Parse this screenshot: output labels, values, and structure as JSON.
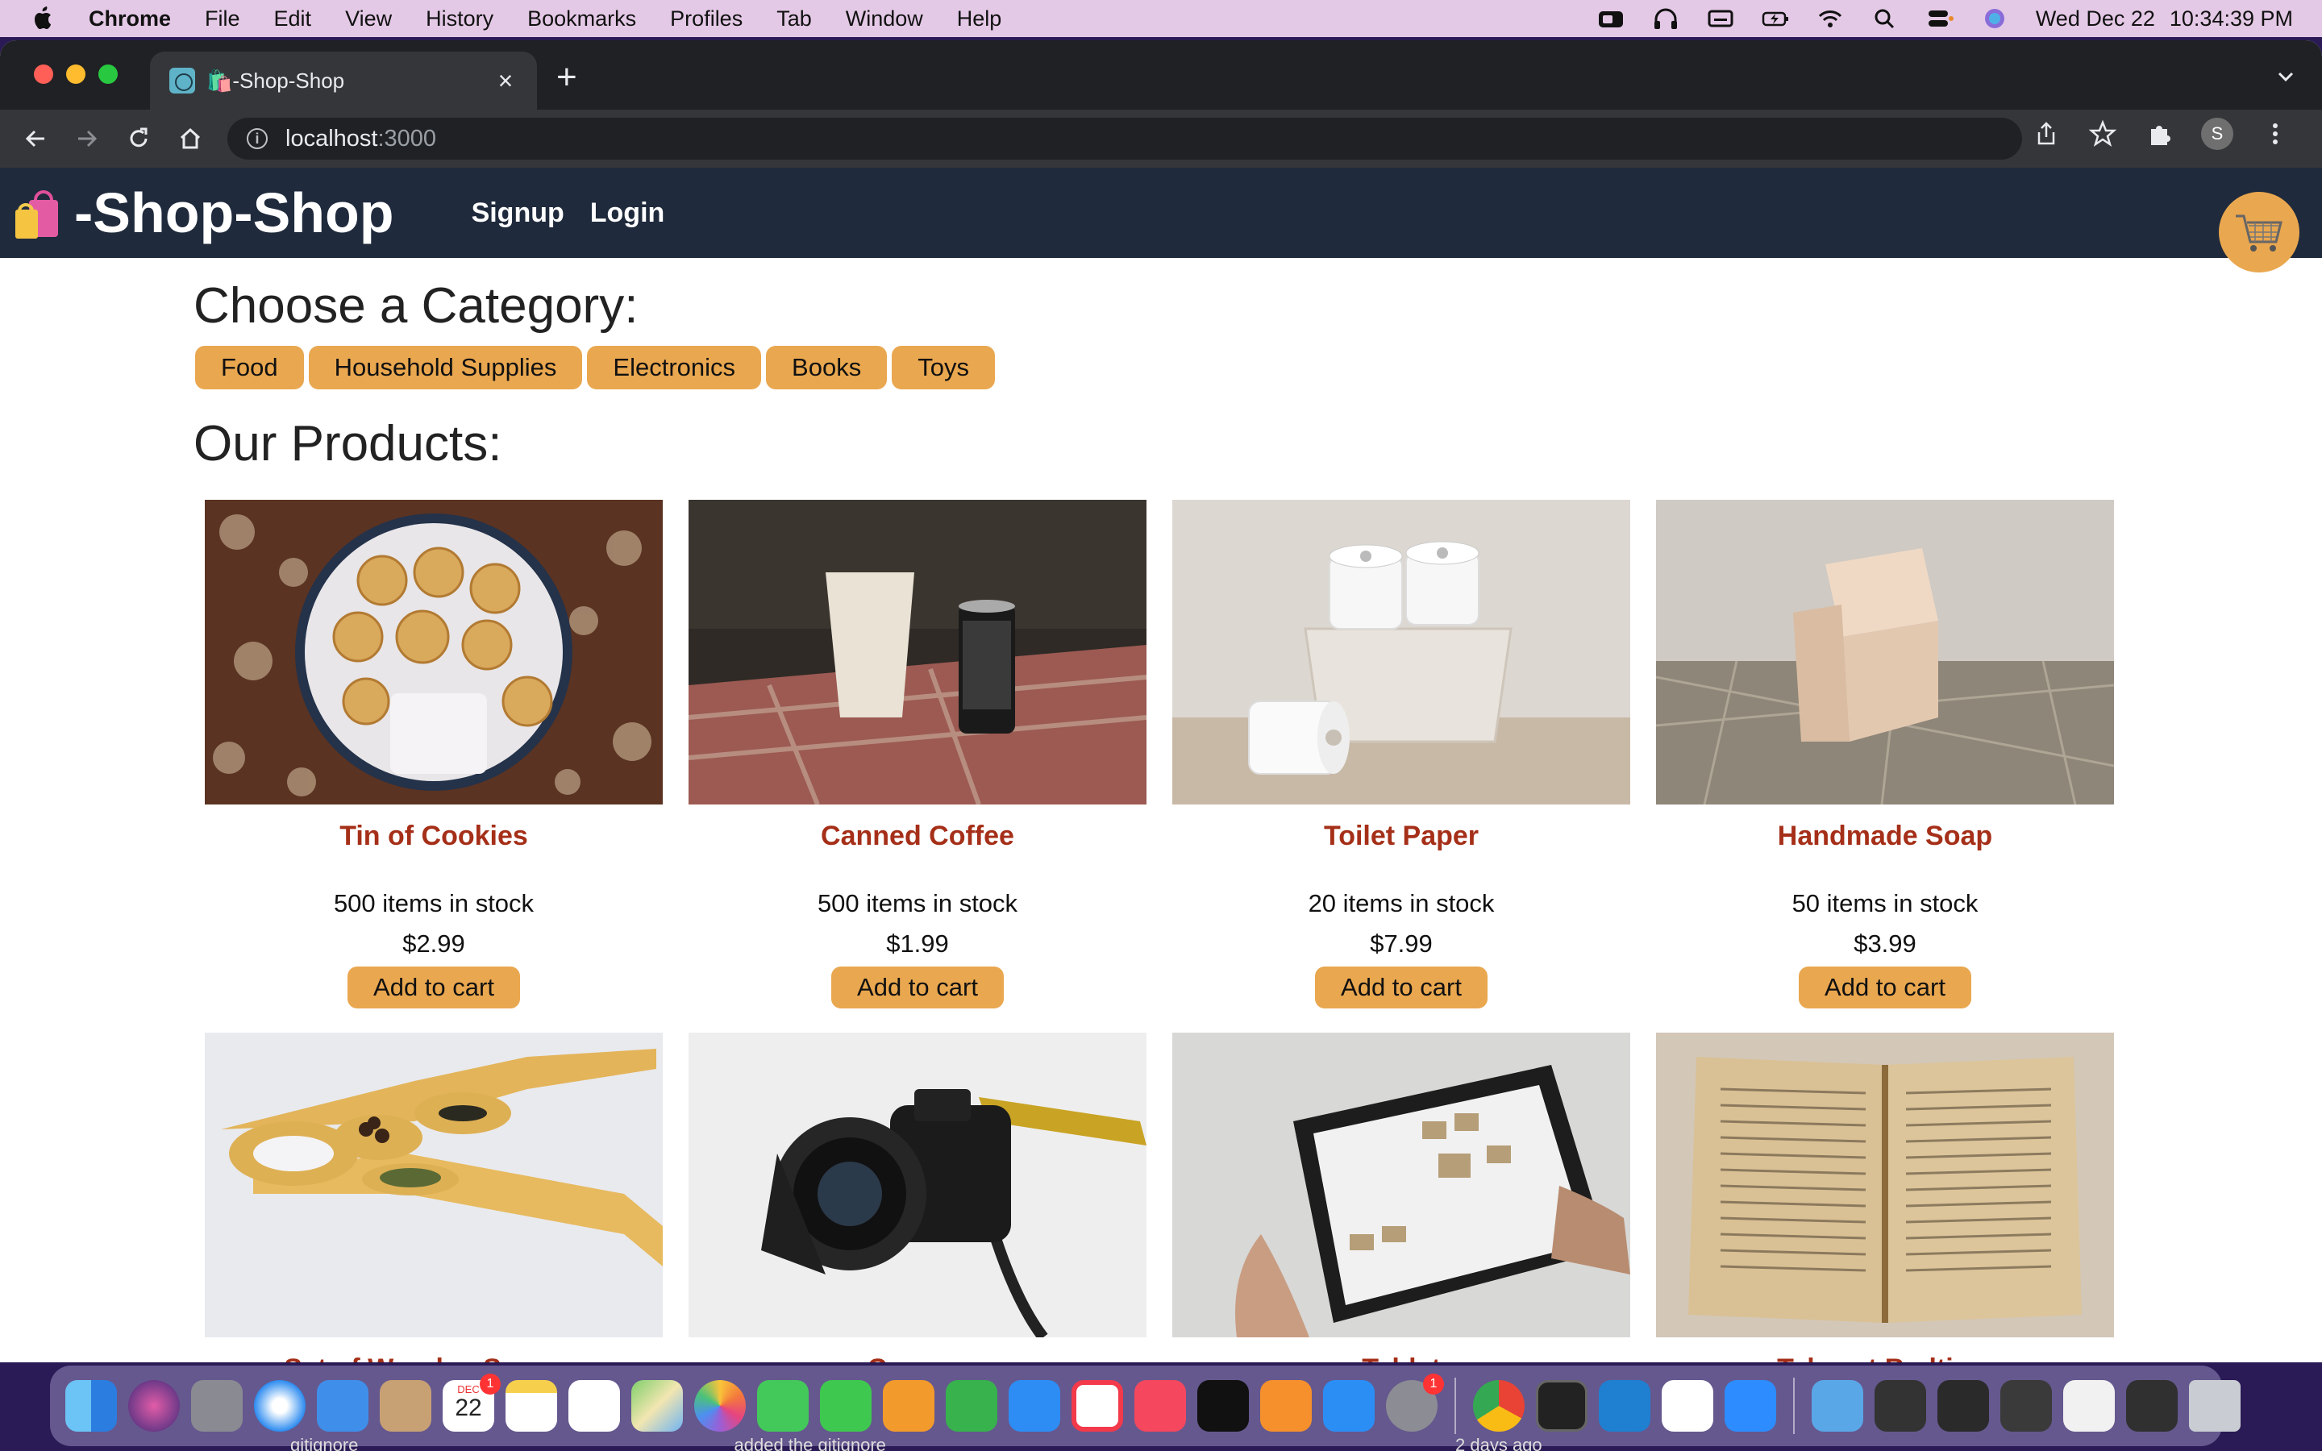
{
  "menubar": {
    "app_name": "Chrome",
    "items": [
      "File",
      "Edit",
      "View",
      "History",
      "Bookmarks",
      "Profiles",
      "Tab",
      "Window",
      "Help"
    ],
    "clock_date": "Wed Dec 22",
    "clock_time": "10:34:39 PM"
  },
  "browser": {
    "tab_title": "🛍️-Shop-Shop",
    "new_tab": "+",
    "url_host": "localhost",
    "url_port": ":3000",
    "profile_initial": "S"
  },
  "site": {
    "logo_emoji": "🛍️",
    "logo_text": "-Shop-Shop",
    "nav": {
      "signup": "Signup",
      "login": "Login"
    }
  },
  "categories": {
    "heading": "Choose a Category:",
    "items": [
      "Food",
      "Household Supplies",
      "Electronics",
      "Books",
      "Toys"
    ]
  },
  "products": {
    "heading": "Our Products:",
    "add_label": "Add to cart",
    "items": [
      {
        "name": "Tin of Cookies",
        "stock": "500 items in stock",
        "price": "$2.99",
        "image": "cookies"
      },
      {
        "name": "Canned Coffee",
        "stock": "500 items in stock",
        "price": "$1.99",
        "image": "coffee"
      },
      {
        "name": "Toilet Paper",
        "stock": "20 items in stock",
        "price": "$7.99",
        "image": "toilet-paper"
      },
      {
        "name": "Handmade Soap",
        "stock": "50 items in stock",
        "price": "$3.99",
        "image": "soap"
      },
      {
        "name": "Set of Wooden Spoons",
        "image": "spoons"
      },
      {
        "name": "Camera",
        "image": "camera"
      },
      {
        "name": "Tablet",
        "image": "tablet"
      },
      {
        "name": "Tales at Bedtime",
        "image": "book"
      }
    ]
  },
  "dock": {
    "calendar_month": "DEC",
    "calendar_day": "22",
    "badge": "1",
    "below_text_left": "gitignore",
    "below_text_mid": "added the gitignore",
    "below_text_right": "2 days ago"
  },
  "colors": {
    "accent": "#e9a74f",
    "header_bg": "#1f2a3c",
    "product_name": "#a52f18"
  }
}
